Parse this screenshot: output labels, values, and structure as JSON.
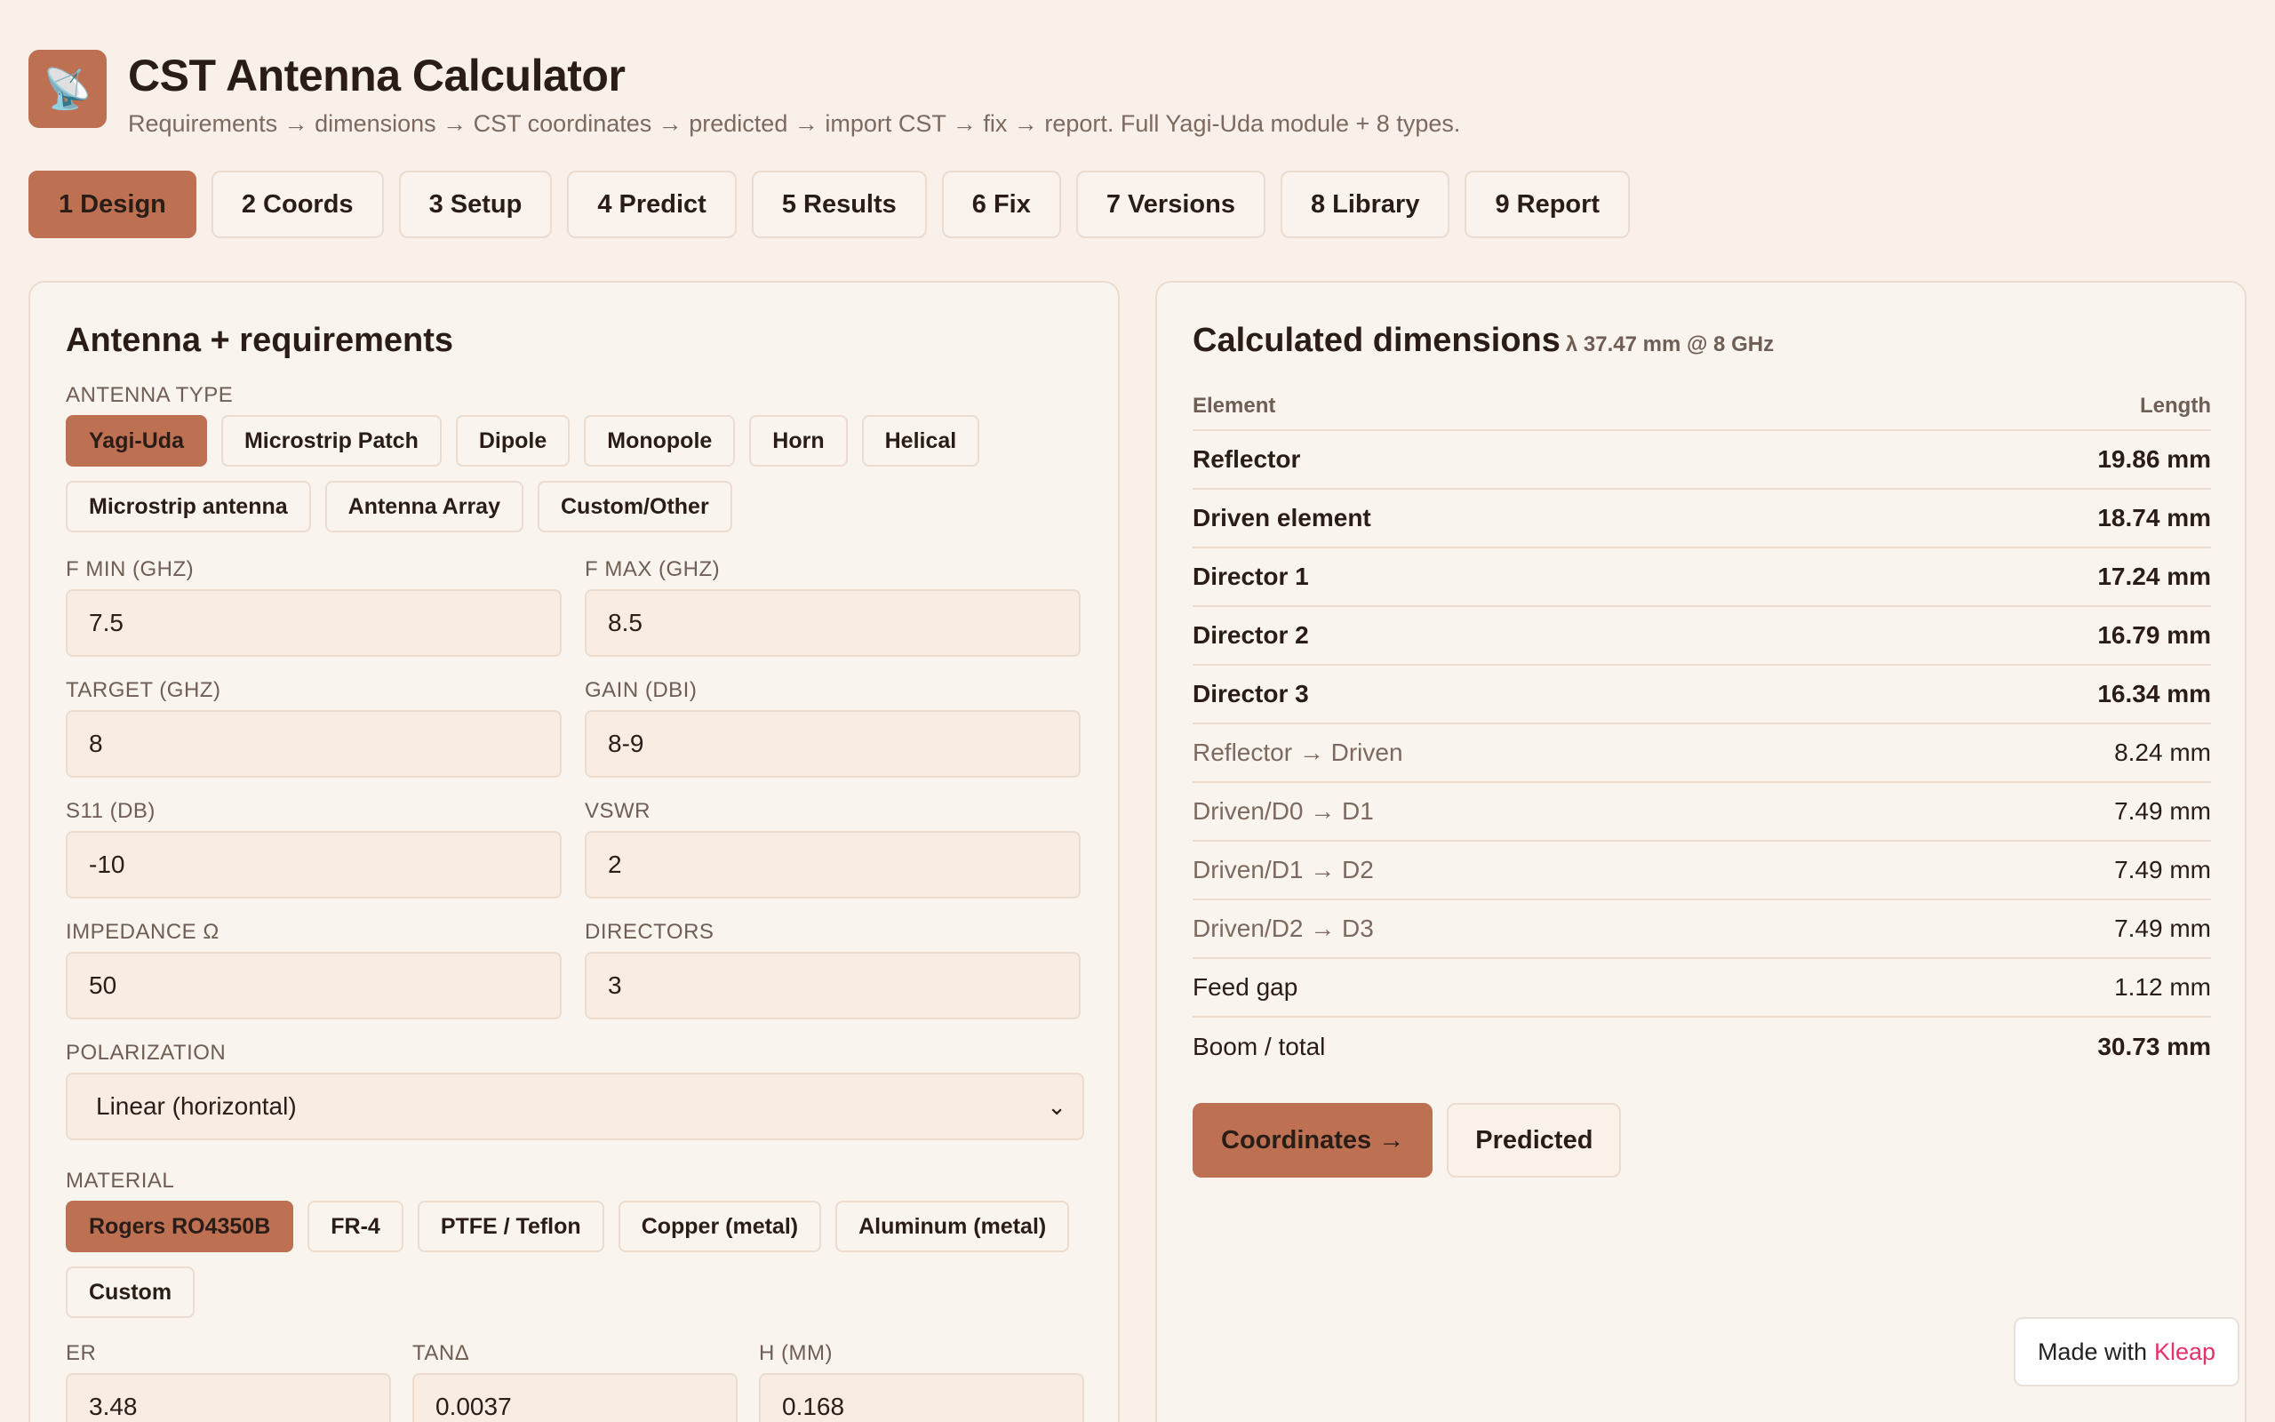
{
  "app": {
    "logo_icon": "📡",
    "title": "CST Antenna Calculator",
    "subtitle": "Requirements → dimensions → CST coordinates → predicted → import CST → fix → report. Full Yagi-Uda module + 8 types."
  },
  "tabs": [
    "1 Design",
    "2 Coords",
    "3 Setup",
    "4 Predict",
    "5 Results",
    "6 Fix",
    "7 Versions",
    "8 Library",
    "9 Report"
  ],
  "active_tab": "1 Design",
  "left": {
    "title": "Antenna + requirements",
    "antenna_type_label": "ANTENNA TYPE",
    "antenna_types": [
      "Yagi-Uda",
      "Microstrip Patch",
      "Dipole",
      "Monopole",
      "Horn",
      "Helical",
      "Microstrip antenna",
      "Antenna Array",
      "Custom/Other"
    ],
    "selected_antenna_type": "Yagi-Uda",
    "fields": [
      {
        "label": "F MIN (GHZ)",
        "value": "7.5"
      },
      {
        "label": "F MAX (GHZ)",
        "value": "8.5"
      },
      {
        "label": "TARGET (GHZ)",
        "value": "8"
      },
      {
        "label": "GAIN (DBI)",
        "value": "8-9"
      },
      {
        "label": "S11 (DB)",
        "value": "-10"
      },
      {
        "label": "VSWR",
        "value": "2"
      },
      {
        "label": "IMPEDANCE Ω",
        "value": "50"
      },
      {
        "label": "DIRECTORS",
        "value": "3"
      }
    ],
    "polarization_label": "POLARIZATION",
    "polarization_value": "Linear (horizontal)",
    "material_label": "MATERIAL",
    "materials": [
      "Rogers RO4350B",
      "FR-4",
      "PTFE / Teflon",
      "Copper (metal)",
      "Aluminum (metal)",
      "Custom"
    ],
    "selected_material": "Rogers RO4350B",
    "substrate_fields": [
      {
        "label": "ER",
        "value": "3.48"
      },
      {
        "label": "TANΔ",
        "value": "0.0037"
      },
      {
        "label": "H (MM)",
        "value": "0.168"
      }
    ]
  },
  "right": {
    "title": "Calculated dimensions",
    "subtitle": "λ 37.47 mm @ 8 GHz",
    "col_element": "Element",
    "col_length": "Length",
    "rows": [
      {
        "element": "Reflector",
        "length": "19.86 mm",
        "style": "bold"
      },
      {
        "element": "Driven element",
        "length": "18.74 mm",
        "style": "bold"
      },
      {
        "element": "Director 1",
        "length": "17.24 mm",
        "style": "bold"
      },
      {
        "element": "Director 2",
        "length": "16.79 mm",
        "style": "bold"
      },
      {
        "element": "Director 3",
        "length": "16.34 mm",
        "style": "bold"
      },
      {
        "element": "Reflector → Driven",
        "length": "8.24 mm",
        "style": "muted"
      },
      {
        "element": "Driven/D0 → D1",
        "length": "7.49 mm",
        "style": "muted"
      },
      {
        "element": "Driven/D1 → D2",
        "length": "7.49 mm",
        "style": "muted"
      },
      {
        "element": "Driven/D2 → D3",
        "length": "7.49 mm",
        "style": "muted"
      },
      {
        "element": "Feed gap",
        "length": "1.12 mm",
        "style": "plain"
      },
      {
        "element": "Boom / total",
        "length": "30.73 mm",
        "style": "boldlen"
      }
    ],
    "primary_button": "Coordinates →",
    "secondary_button": "Predicted"
  },
  "badge": {
    "prefix": "Made with",
    "brand": "Kleap"
  },
  "colors": {
    "accent": "#bd7052",
    "background": "#f8f0e9",
    "brand_pink": "#e5326a"
  }
}
